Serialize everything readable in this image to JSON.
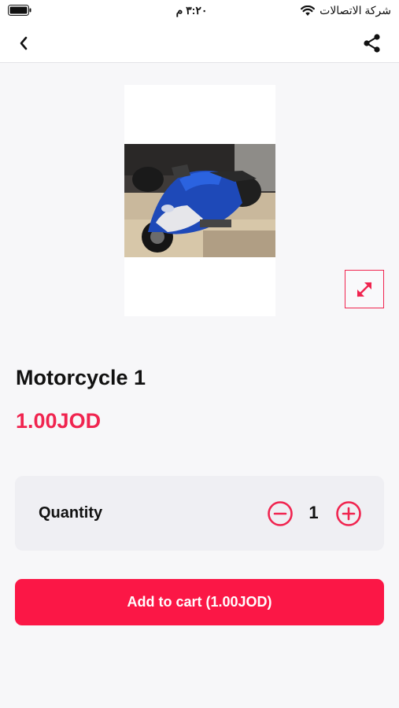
{
  "status_bar": {
    "time": "٣:٢٠ م",
    "carrier": "شركة الاتصالات",
    "wifi_icon": "wifi-icon",
    "battery_icon": "battery-icon"
  },
  "nav": {
    "back_icon": "chevron-left-icon",
    "share_icon": "share-icon"
  },
  "product": {
    "image_icon": "motorcycle-photo",
    "expand_icon": "expand-icon",
    "title": "Motorcycle 1",
    "price": "1.00JOD"
  },
  "quantity": {
    "label": "Quantity",
    "value": "1",
    "minus_icon": "minus-circle-icon",
    "plus_icon": "plus-circle-icon"
  },
  "cart": {
    "button_label": "Add to cart (1.00JOD)"
  },
  "colors": {
    "accent": "#f0244f",
    "button_bg": "#fb1746",
    "background": "#f7f7f9",
    "card_bg": "#efeff3"
  }
}
